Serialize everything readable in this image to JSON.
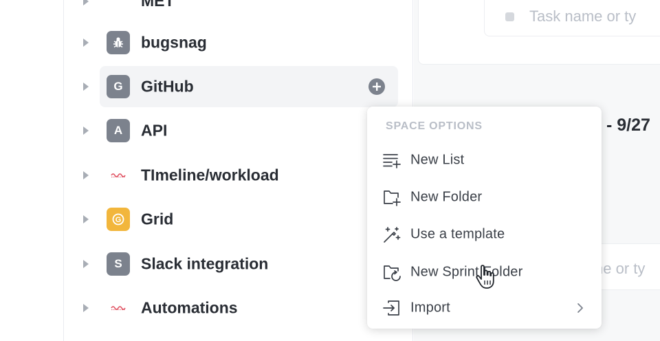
{
  "sidebar": {
    "partial_top_label": "MET",
    "spaces": [
      {
        "name": "bugsnag",
        "avatar_letter": "",
        "avatar_icon": "bug-icon"
      },
      {
        "name": "GitHub",
        "avatar_letter": "G",
        "hovered": true
      },
      {
        "name": "API",
        "avatar_letter": "A"
      },
      {
        "name": "TImeline/workload",
        "avatar_icon": "wavy-line-icon"
      },
      {
        "name": "Grid",
        "avatar_letter": "G",
        "avatar_color": "#f2b63c"
      },
      {
        "name": "Slack integration",
        "avatar_letter": "S"
      },
      {
        "name": "Automations",
        "avatar_icon": "wavy-line-icon"
      }
    ]
  },
  "main": {
    "task_placeholder_top": "Task name or ty",
    "date_partial": "- 9/27",
    "task_placeholder_bottom": "ne or ty"
  },
  "space_menu": {
    "header": "SPACE OPTIONS",
    "items": [
      {
        "label": "New List",
        "icon": "new-list-icon"
      },
      {
        "label": "New Folder",
        "icon": "new-folder-icon"
      },
      {
        "label": "Use a template",
        "icon": "magic-wand-icon"
      },
      {
        "label": "New Sprint Folder",
        "icon": "sprint-folder-icon"
      },
      {
        "label": "Import",
        "icon": "import-icon",
        "has_submenu": true
      }
    ]
  },
  "colors": {
    "avatar_gray": "#7c828d",
    "avatar_yellow": "#f2b63c",
    "wavy_red": "#e04f5f",
    "hover_bg": "#f3f4f6"
  }
}
